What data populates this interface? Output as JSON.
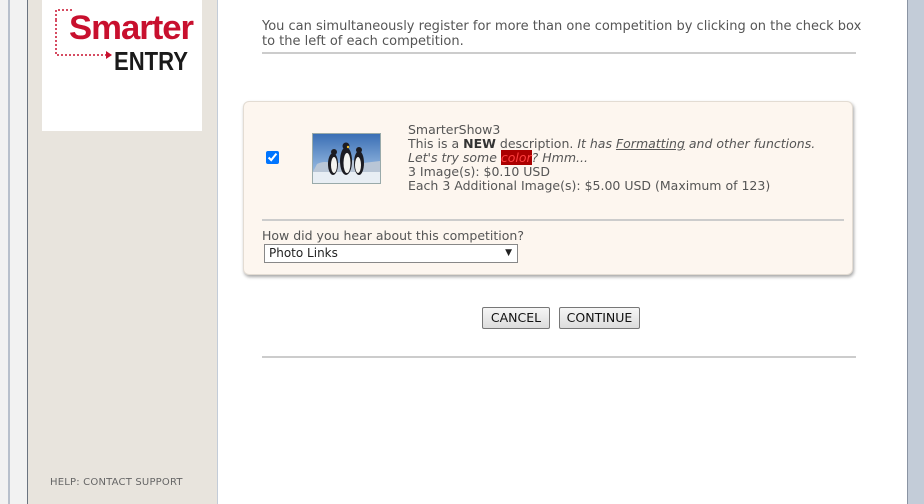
{
  "logo": {
    "line1": "Smarter",
    "line2": "ENTRY"
  },
  "sidebar": {
    "help_text": "HELP: CONTACT SUPPORT"
  },
  "intro": {
    "text": "You can simultaneously register for more than one competition by clicking on the check box to the left of each competition."
  },
  "competition": {
    "checked": true,
    "name": "SmarterShow3",
    "desc_prefix": "This is a ",
    "desc_bold": "NEW",
    "desc_mid": " description.  ",
    "desc_italic1": "It has ",
    "desc_underline": "Formatting",
    "desc_italic2": " and other functions.",
    "desc_italic3": "Let's try some ",
    "desc_highlight": "color",
    "desc_italic4": "? Hmm...",
    "price_line": "3 Image(s): $0.10 USD",
    "additional_line": "Each 3 Additional Image(s): $5.00 USD (Maximum of 123)",
    "thumbnail_icon": "penguins-photo"
  },
  "hear": {
    "label": "How did you hear about this competition?",
    "selected": "Photo Links"
  },
  "buttons": {
    "cancel": "CANCEL",
    "continue": "CONTINUE"
  },
  "colors": {
    "logo_red": "#c8102e",
    "card_bg": "#fdf6ef",
    "sidebar_bg": "#e8e4dd"
  }
}
